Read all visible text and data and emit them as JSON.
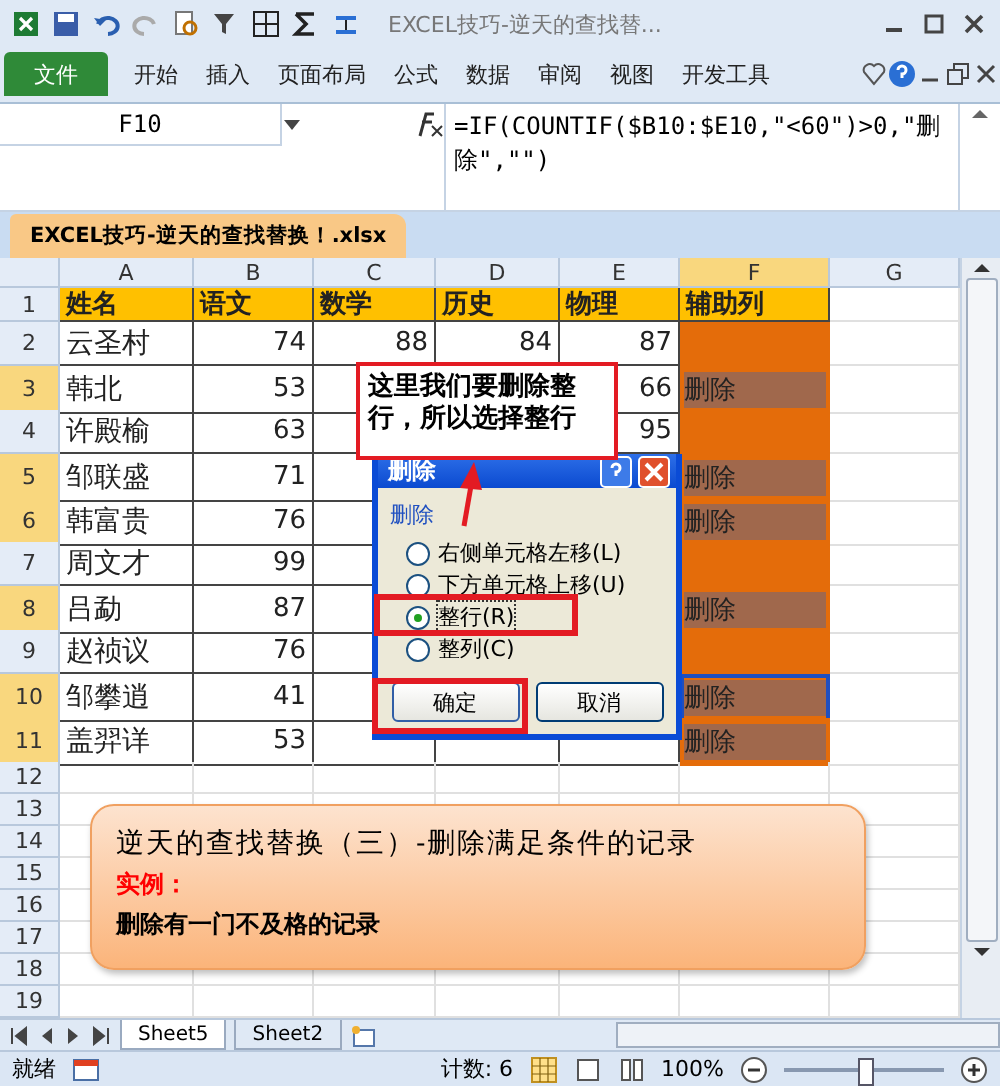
{
  "window": {
    "title": "EXCEL技巧-逆天的查找替..."
  },
  "ribbon_tabs": [
    {
      "label": "文件",
      "kind": "file"
    },
    {
      "label": "开始",
      "kind": "tab"
    },
    {
      "label": "插入",
      "kind": "tab"
    },
    {
      "label": "页面布局",
      "kind": "tab"
    },
    {
      "label": "公式",
      "kind": "tab"
    },
    {
      "label": "数据",
      "kind": "tab"
    },
    {
      "label": "审阅",
      "kind": "tab"
    },
    {
      "label": "视图",
      "kind": "tab"
    },
    {
      "label": "开发工具",
      "kind": "tab"
    }
  ],
  "formula_bar": {
    "name_box": "F10",
    "formula": "=IF(COUNTIF($B10:$E10,\"<60\")>0,\"删除\",\"\")"
  },
  "workbook_tab": {
    "label": "EXCEL技巧-逆天的查找替换！.xlsx"
  },
  "columns": [
    {
      "label": "A",
      "selected": false
    },
    {
      "label": "B",
      "selected": false
    },
    {
      "label": "C",
      "selected": false
    },
    {
      "label": "D",
      "selected": false
    },
    {
      "label": "E",
      "selected": false
    },
    {
      "label": "F",
      "selected": true
    },
    {
      "label": "G",
      "selected": false
    }
  ],
  "rows": [
    {
      "num": "1",
      "kind": "header",
      "selected": false,
      "cells": [
        "姓名",
        "语文",
        "数学",
        "历史",
        "物理",
        "辅助列"
      ]
    },
    {
      "num": "2",
      "kind": "data",
      "selected": false,
      "active": false,
      "cells": [
        "云圣村",
        "74",
        "88",
        "84",
        "87",
        null
      ]
    },
    {
      "num": "3",
      "kind": "data",
      "selected": true,
      "active": false,
      "cells": [
        "韩北",
        "53",
        null,
        null,
        "66",
        "删除"
      ]
    },
    {
      "num": "4",
      "kind": "data",
      "selected": false,
      "active": false,
      "cells": [
        "许殿榆",
        "63",
        null,
        null,
        "95",
        null
      ]
    },
    {
      "num": "5",
      "kind": "data",
      "selected": true,
      "active": false,
      "cells": [
        "邹联盛",
        "71",
        null,
        null,
        null,
        "删除"
      ]
    },
    {
      "num": "6",
      "kind": "data",
      "selected": true,
      "active": false,
      "cells": [
        "韩富贵",
        "76",
        null,
        null,
        null,
        "删除"
      ]
    },
    {
      "num": "7",
      "kind": "data",
      "selected": false,
      "active": false,
      "cells": [
        "周文才",
        "99",
        null,
        null,
        null,
        null
      ]
    },
    {
      "num": "8",
      "kind": "data",
      "selected": true,
      "active": false,
      "cells": [
        "吕勐",
        "87",
        null,
        null,
        null,
        "删除"
      ]
    },
    {
      "num": "9",
      "kind": "data",
      "selected": false,
      "active": false,
      "cells": [
        "赵祯议",
        "76",
        null,
        null,
        null,
        null
      ]
    },
    {
      "num": "10",
      "kind": "data",
      "selected": true,
      "active": true,
      "cells": [
        "邹攀逍",
        "41",
        null,
        null,
        null,
        "删除"
      ]
    },
    {
      "num": "11",
      "kind": "data",
      "selected": true,
      "active": false,
      "cells": [
        "盖羿详",
        "53",
        null,
        null,
        null,
        "删除"
      ]
    },
    {
      "num": "12",
      "kind": "empty",
      "selected": false
    },
    {
      "num": "13",
      "kind": "empty",
      "selected": false
    },
    {
      "num": "14",
      "kind": "empty",
      "selected": false
    },
    {
      "num": "15",
      "kind": "empty",
      "selected": false
    },
    {
      "num": "16",
      "kind": "empty",
      "selected": false
    },
    {
      "num": "17",
      "kind": "empty",
      "selected": false
    },
    {
      "num": "18",
      "kind": "empty",
      "selected": false
    },
    {
      "num": "19",
      "kind": "empty",
      "selected": false
    }
  ],
  "callout": {
    "text": "这里我们要删除整行，所以选择整行"
  },
  "dialog": {
    "title": "删除",
    "group": "删除",
    "options": [
      {
        "label": "右侧单元格左移(L)",
        "selected": false
      },
      {
        "label": "下方单元格上移(U)",
        "selected": false
      },
      {
        "label": "整行(R)",
        "selected": true
      },
      {
        "label": "整列(C)",
        "selected": false
      }
    ],
    "buttons": [
      {
        "label": "确定",
        "kind": "primary"
      },
      {
        "label": "取消",
        "kind": "normal"
      }
    ]
  },
  "note": {
    "title": "逆天的查找替换（三）-删除满足条件的记录",
    "label": "实例：",
    "body": "删除有一门不及格的记录"
  },
  "sheet_tabs": [
    {
      "label": "Sheet5",
      "selected": true
    },
    {
      "label": "Sheet2",
      "selected": false
    }
  ],
  "status_bar": {
    "mode": "就绪",
    "count": "计数: 6",
    "zoom": {
      "text": "100%",
      "level": 0.5
    }
  }
}
